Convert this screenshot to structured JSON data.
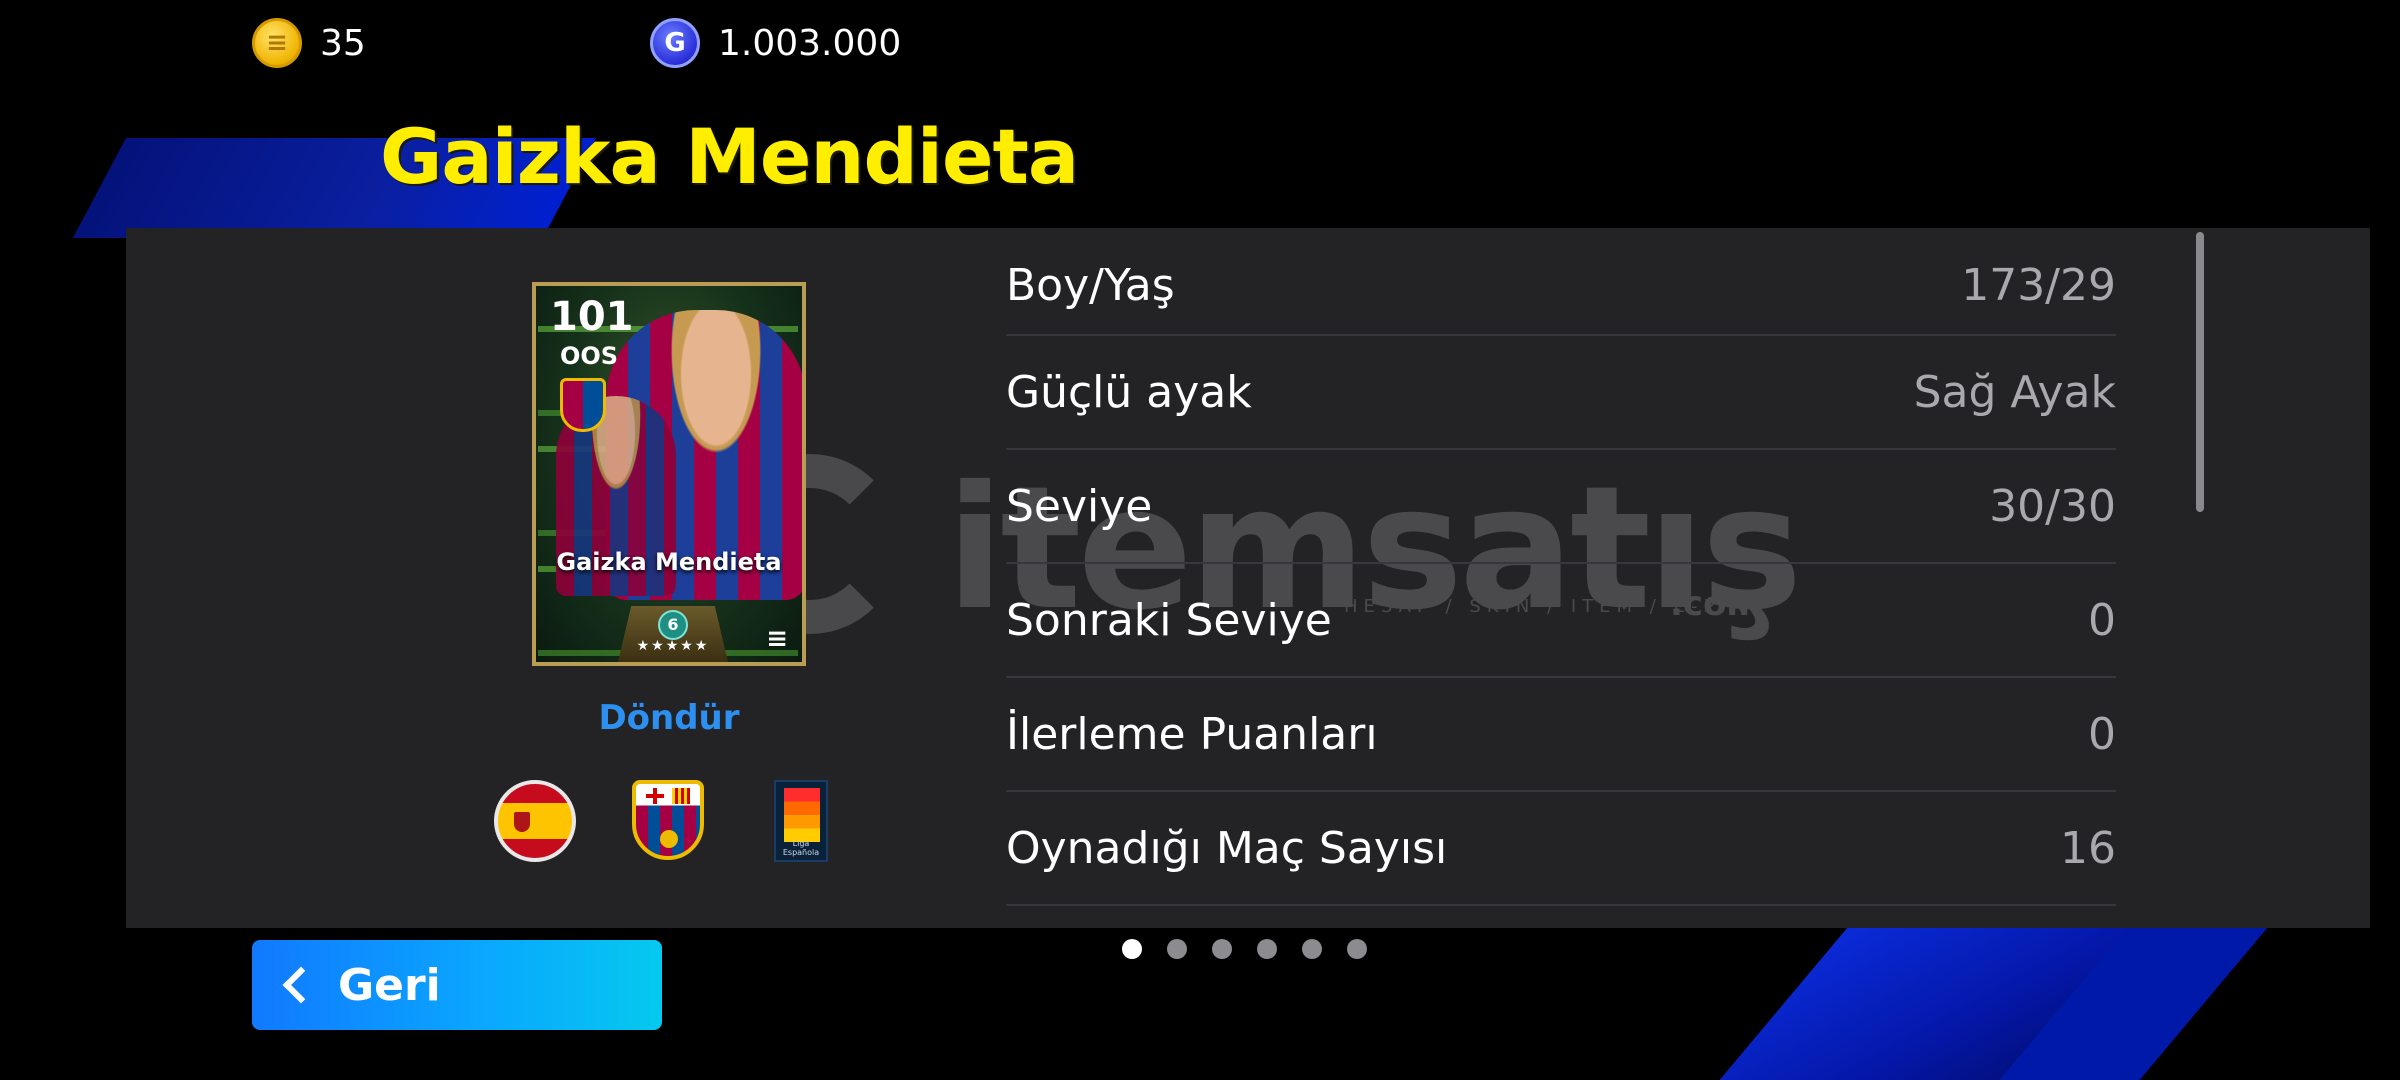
{
  "currency": {
    "coins": {
      "icon": "e-coin-icon",
      "amount": "35",
      "color": "#f0b400"
    },
    "gp": {
      "icon": "gp-coin-icon",
      "symbol": "G",
      "amount": "1.003.000",
      "color": "#2a2fd8"
    }
  },
  "player": {
    "name": "Gaizka Mendieta",
    "card": {
      "rating": "101",
      "position": "OOS",
      "name": "Gaizka Mendieta",
      "stars": "★★★★★",
      "badge_symbol": "6",
      "brand_glyph": "≡"
    },
    "rotate_label": "Döndür",
    "nationality": "spain-flag-icon",
    "club": "fc-barcelona-crest-icon",
    "league": {
      "icon": "laliga-icon",
      "text": "Liga Española"
    }
  },
  "stats": [
    {
      "label": "Boy/Yaş",
      "value": "173/29"
    },
    {
      "label": "Güçlü ayak",
      "value": "Sağ Ayak"
    },
    {
      "label": "Seviye",
      "value": "30/30"
    },
    {
      "label": "Sonraki Seviye",
      "value": "0"
    },
    {
      "label": "İlerleme Puanları",
      "value": "0"
    },
    {
      "label": "Oynadığı Maç Sayısı",
      "value": "16"
    }
  ],
  "watermark": {
    "text": "itemsatış",
    "sub": "HESAP / SKIN / ITEM / E-PIN",
    "suffix": ".com"
  },
  "pager": {
    "total": 6,
    "active": 1
  },
  "back_button": {
    "label": "Geri",
    "icon": "chevron-left-icon"
  },
  "colors": {
    "title": "#ffee00",
    "panel": "#232325",
    "link": "#2d8ff0",
    "button_start": "#1179ff",
    "button_end": "#05c9ee"
  }
}
